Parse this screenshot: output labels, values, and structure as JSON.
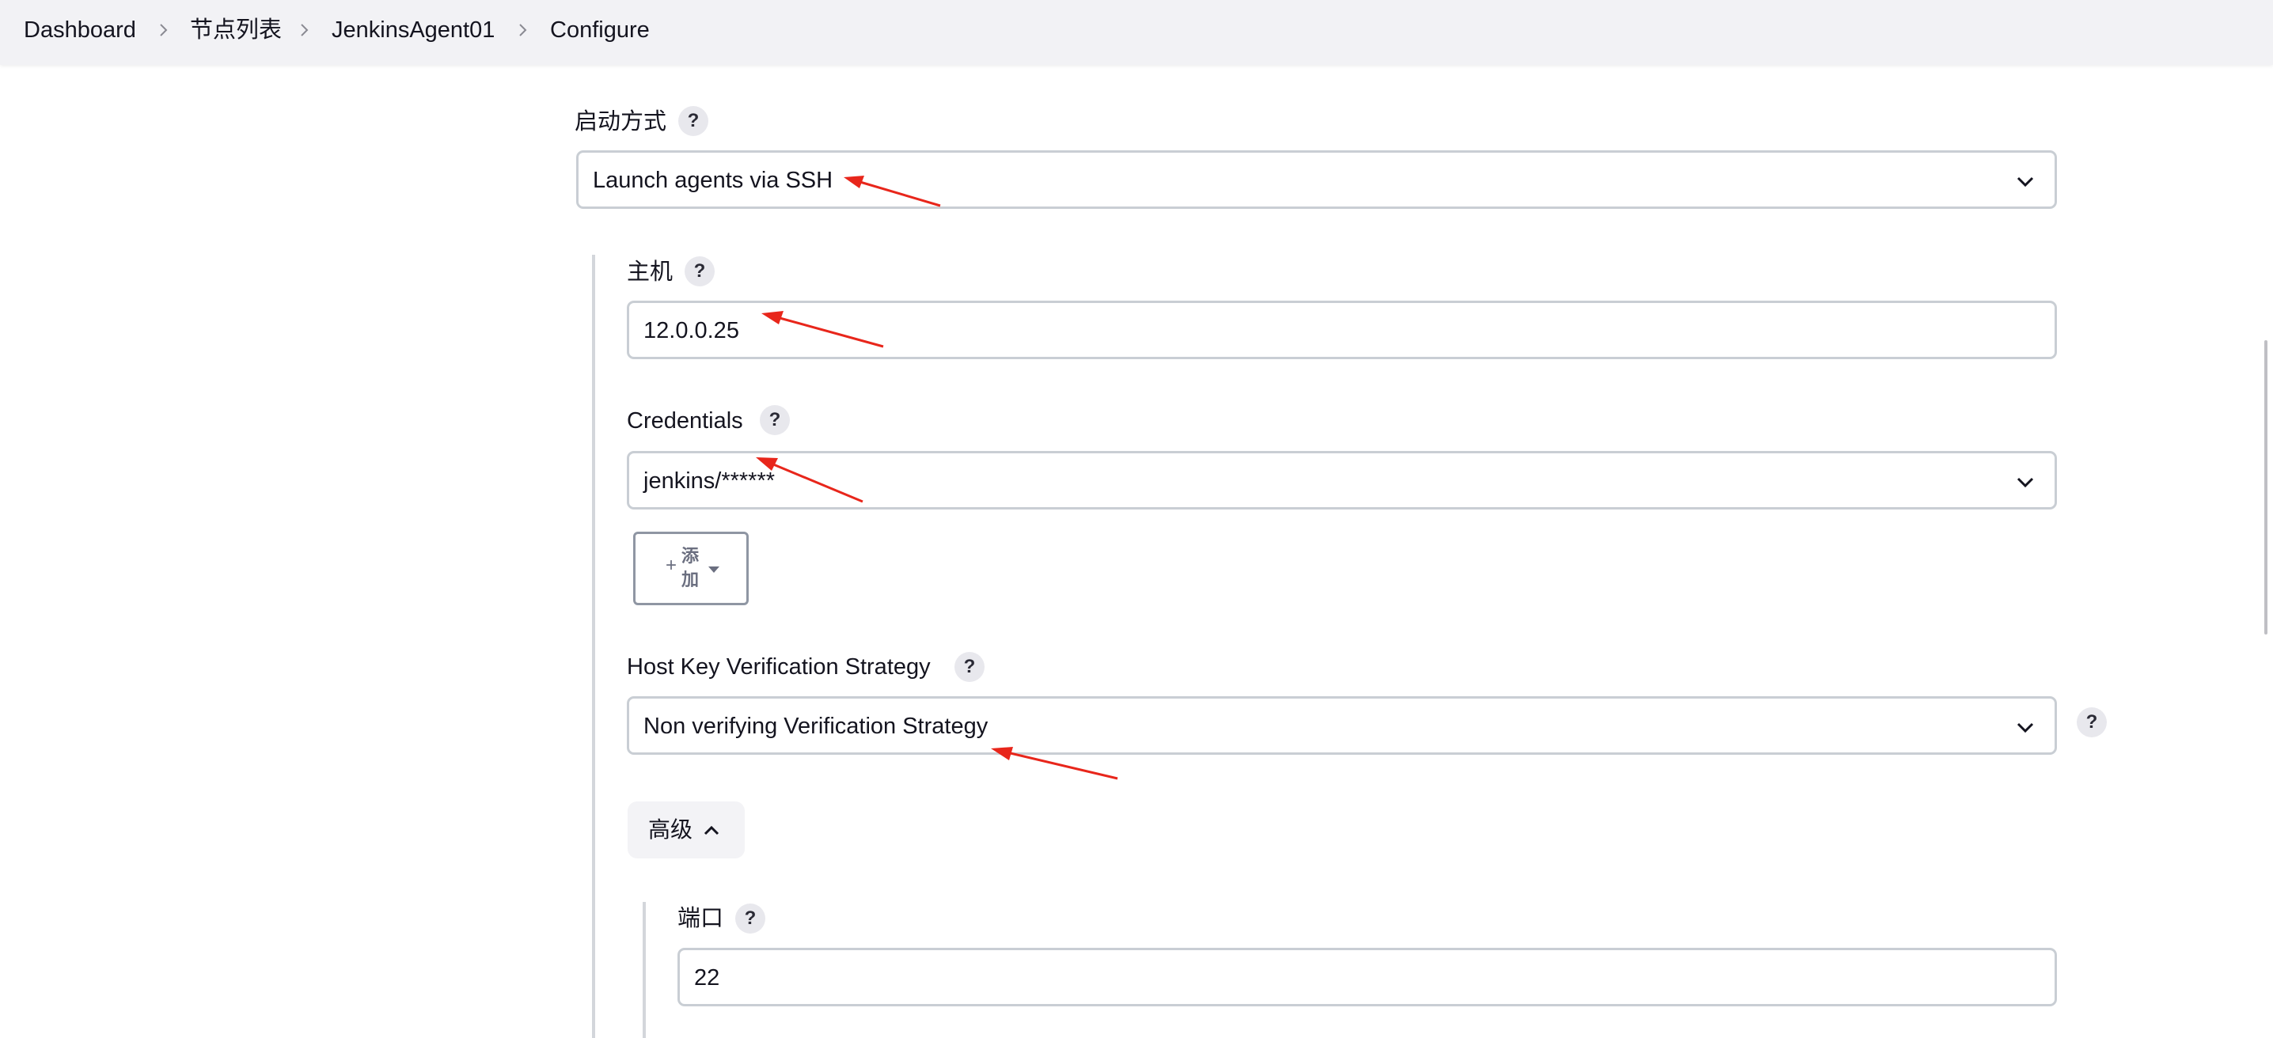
{
  "breadcrumb": {
    "items": [
      "Dashboard",
      "节点列表",
      "JenkinsAgent01",
      "Configure"
    ]
  },
  "launch_method": {
    "label": "启动方式",
    "help": "?",
    "selected": "Launch agents via SSH"
  },
  "host": {
    "label": "主机",
    "help": "?",
    "value": "12.0.0.25"
  },
  "credentials": {
    "label": "Credentials",
    "help": "?",
    "selected": "jenkins/******",
    "add_button": {
      "plus": "+",
      "label_line1": "添",
      "label_line2": "加"
    }
  },
  "host_key": {
    "label": "Host Key Verification Strategy",
    "help": "?",
    "selected": "Non verifying Verification Strategy",
    "side_help": "?"
  },
  "advanced": {
    "label": "高级"
  },
  "port": {
    "label": "端口",
    "help": "?",
    "value": "22"
  },
  "colors": {
    "annotation_arrow": "#e8261b",
    "topbar_bg": "#f2f2f5",
    "field_border": "#c9ced4"
  },
  "icons": [
    "chevron-right-icon",
    "chevron-down-icon",
    "chevron-up-icon",
    "caret-down-icon",
    "help-icon"
  ]
}
